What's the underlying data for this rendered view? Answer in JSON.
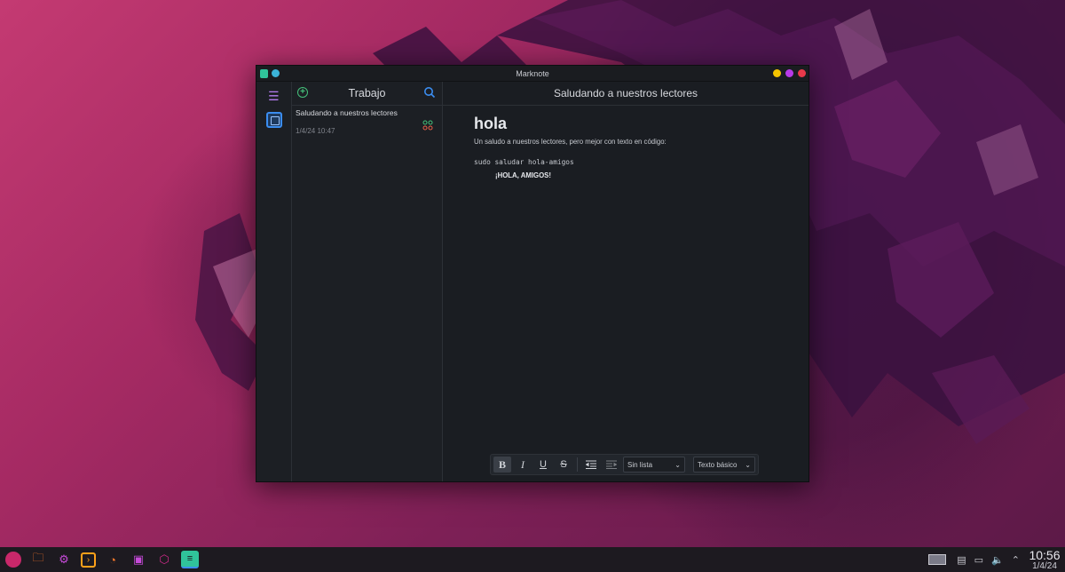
{
  "window": {
    "title": "Marknote",
    "controls": {
      "minimize_color": "#f5c400",
      "maximize_color": "#b83ae8",
      "close_color": "#e8394a"
    }
  },
  "sidebar": {
    "menu_icon": "hamburger-icon",
    "notebook_icon": "notebook-icon"
  },
  "note_list": {
    "notebook_title": "Trabajo",
    "add_icon": "plus-circle-icon",
    "search_icon": "search-icon",
    "notes": [
      {
        "title": "Saludando a nuestros lectores",
        "date": "1/4/24 10:47"
      }
    ]
  },
  "editor": {
    "note_title": "Saludando a nuestros lectores",
    "heading": "hola",
    "paragraph": "Un saludo a nuestros lectores, pero mejor con texto en código:",
    "code": "sudo saludar hola-amigos",
    "bold_text": "¡HOLA, AMIGOS!"
  },
  "format_toolbar": {
    "bold": "B",
    "italic": "I",
    "underline": "U",
    "strike": "S",
    "list_select": "Sin lista",
    "style_select": "Texto básico"
  },
  "taskbar": {
    "apps": [
      "app-launcher-icon",
      "file-manager-icon",
      "settings-icon",
      "terminal-icon",
      "firefox-icon",
      "store-icon",
      "app-icon",
      "marknote-icon"
    ],
    "time": "10:56",
    "date": "1/4/24"
  },
  "colors": {
    "accent": "#3b8df0",
    "window_bg": "#1a1d22"
  }
}
